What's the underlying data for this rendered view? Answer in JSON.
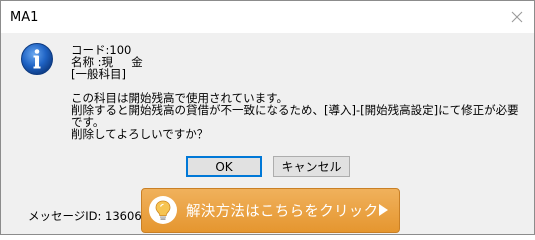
{
  "window": {
    "title": "MA1"
  },
  "message": {
    "code_line": "コード:100",
    "name_line": "名称 :現     金",
    "category_line": "[一般科目]",
    "body_line1": "この科目は開始残高で使用されています。",
    "body_line2": "削除すると開始残高の貸借が不一致になるため、[導入]-[開始残高設定]にて修正が必要",
    "body_line3": "です。",
    "body_line4": "削除してよろしいですか？"
  },
  "buttons": {
    "ok_label": "OK",
    "cancel_label": "キャンセル"
  },
  "footer": {
    "message_id": "メッセージID: 13606",
    "solution_label": "解決方法はこちらをクリック"
  },
  "colors": {
    "solution_bg": "#e99e3a",
    "info_icon": "#1a5fb4"
  },
  "icons": {
    "window_close": "close-icon",
    "message_type": "info-icon",
    "solution_hint": "lightbulb-icon",
    "solution_go": "arrow-right-icon"
  }
}
